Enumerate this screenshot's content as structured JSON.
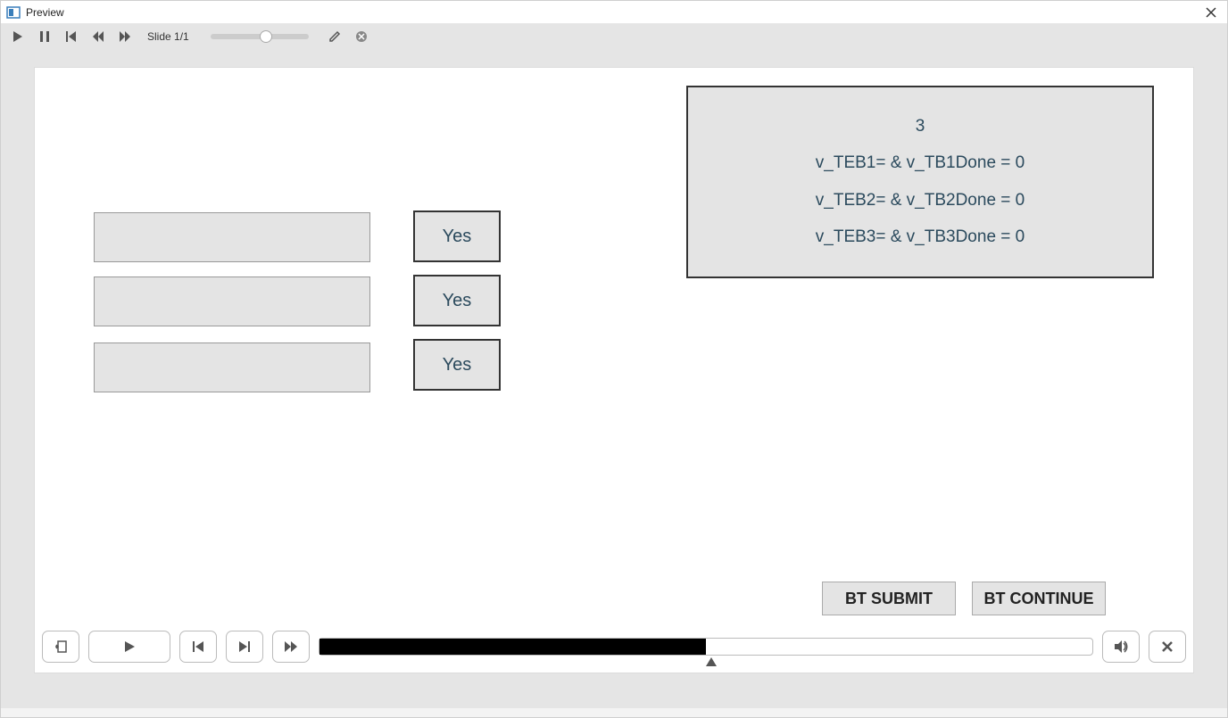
{
  "window": {
    "title": "Preview"
  },
  "toolbar": {
    "slide_counter": "Slide 1/1",
    "slider_position_pct": 50
  },
  "slide": {
    "inputs": [
      {
        "value": ""
      },
      {
        "value": ""
      },
      {
        "value": ""
      }
    ],
    "buttons": [
      {
        "label": "Yes"
      },
      {
        "label": "Yes"
      },
      {
        "label": "Yes"
      }
    ],
    "varbox": {
      "count": "3",
      "lines": [
        "v_TEB1=  & v_TB1Done = 0",
        "v_TEB2=  & v_TB2Done = 0",
        "v_TEB3=  & v_TB3Done = 0"
      ]
    },
    "submit_label": "BT SUBMIT",
    "continue_label": "BT CONTINUE"
  },
  "playbar": {
    "progress_pct": 50
  }
}
